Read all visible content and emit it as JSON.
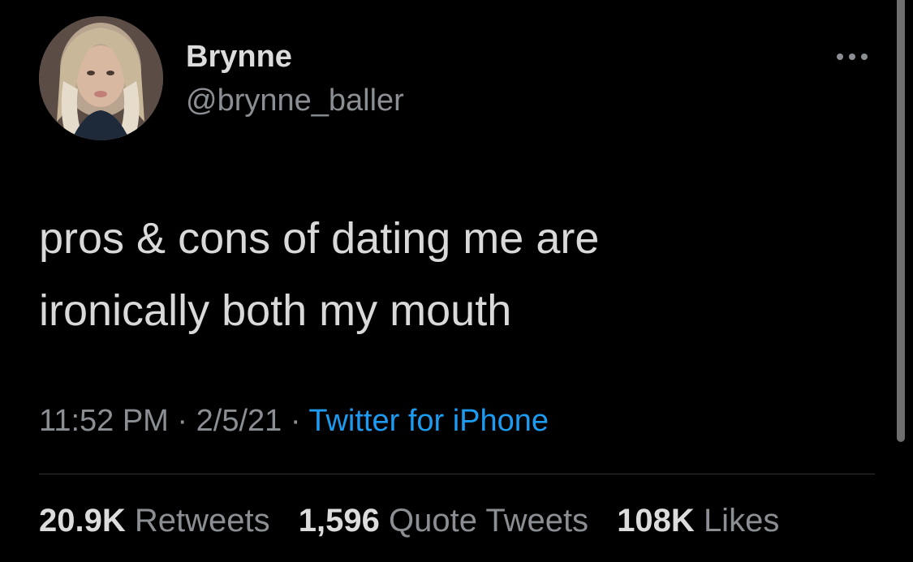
{
  "author": {
    "display_name": "Brynne",
    "handle": "@brynne_baller",
    "avatar_icon": "profile-photo"
  },
  "menu": {
    "icon": "more-horizontal-icon"
  },
  "tweet": {
    "lines": [
      "pros & cons of dating me are",
      "ironically both my mouth"
    ]
  },
  "meta": {
    "time": "11:52 PM",
    "separator": "·",
    "date": "2/5/21",
    "source": "Twitter for iPhone"
  },
  "stats": {
    "retweets_count": "20.9K",
    "retweets_label": "Retweets",
    "quotes_count": "1,596",
    "quotes_label": "Quote Tweets",
    "likes_count": "108K",
    "likes_label": "Likes"
  },
  "colors": {
    "background": "#000000",
    "primary_text": "#d9d9d9",
    "secondary_text": "#8b8f94",
    "link": "#1d9bf0",
    "divider": "#2f3336"
  }
}
